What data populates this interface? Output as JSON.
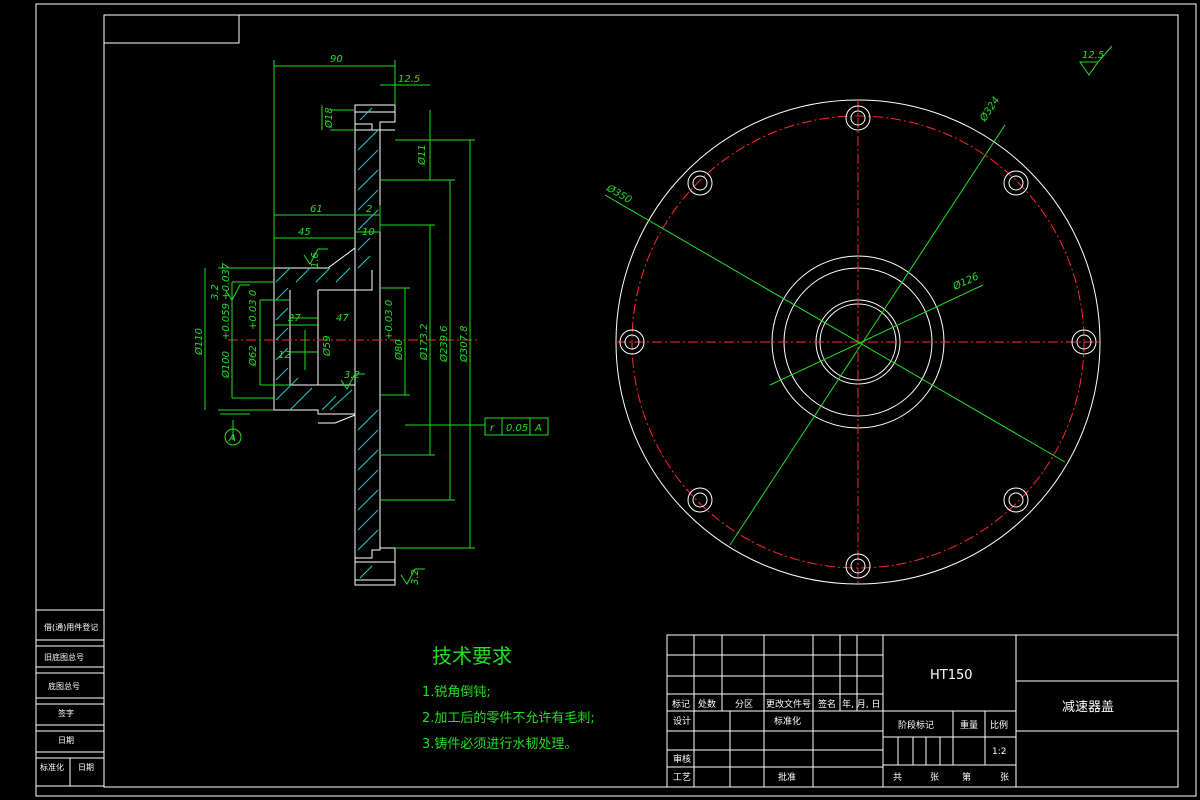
{
  "dims": {
    "d90": "90",
    "d12_5": "12.5",
    "d18": "Ø18",
    "d11": "Ø11",
    "d61": "61",
    "d2": "2",
    "d45": "45",
    "d10": "10",
    "d1_6": "1.6",
    "d3_2a": "3.2",
    "d110": "Ø110",
    "d100": "Ø100",
    "d100tol": "+0.059 +0.037",
    "d62": "Ø62",
    "d62tol": "+0.03 0",
    "d27": "27",
    "d47": "47",
    "d59": "Ø59",
    "d80": "Ø80",
    "d80tol": "+0.03 0",
    "d12": "12",
    "d173": "Ø173.2",
    "d239": "Ø239.6",
    "d307": "Ø307.8",
    "d3_2b": "3.2",
    "d3_2c": "3.2",
    "datum": "A",
    "tol_sym": "r",
    "tol_val": "0.05",
    "tol_ref": "A",
    "rough_top": "12.5",
    "d324": "Ø324",
    "d350": "Ø350",
    "d126": "Ø126"
  },
  "notes": {
    "title": "技术要求",
    "items": [
      "1.锐角倒钝;",
      "2.加工后的零件不允许有毛刺;",
      "3.铸件必须进行水韧处理。"
    ]
  },
  "title_block": {
    "material": "HT150",
    "part_name": "减速器盖",
    "h_mark": "标记",
    "h_qty": "处数",
    "h_zone": "分区",
    "h_doc": "更改文件号",
    "h_sign": "签名",
    "h_date": "年, 月, 日",
    "r_design": "设计",
    "r_std": "标准化",
    "r_check": "审核",
    "r_process": "工艺",
    "r_approve": "批准",
    "stage": "阶段标记",
    "weight": "重量",
    "scale": "比例",
    "scale_val": "1:2",
    "sheets_total": "共",
    "sheets_unit": "张",
    "sheet_no": "第",
    "sheet_unit2": "张"
  },
  "side_block": {
    "r1": "借(通)用件登记",
    "r2": "旧底图总号",
    "r3": "底图总号",
    "r4": "签字",
    "r5": "日期",
    "r6a": "标准化",
    "r6b": "日期"
  }
}
